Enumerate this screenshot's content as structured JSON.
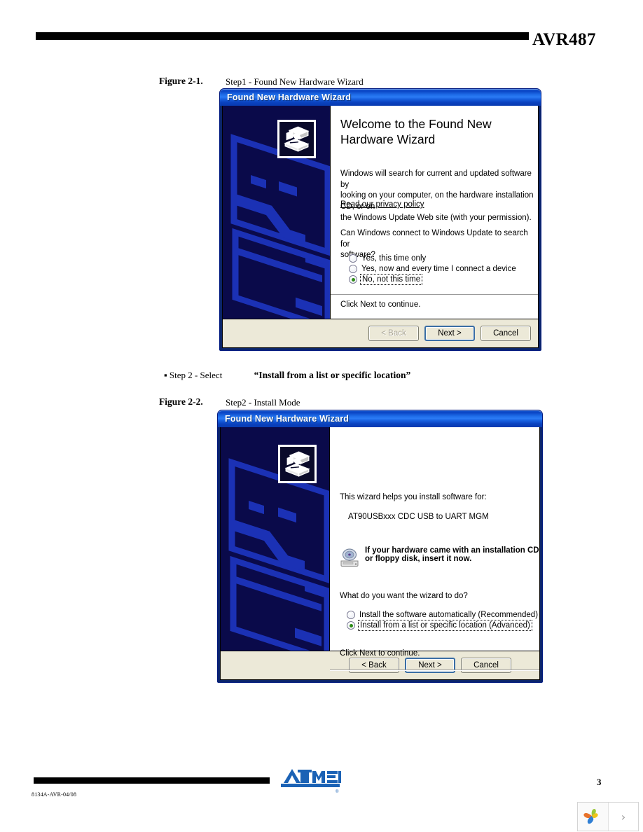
{
  "page": {
    "header_title": "AVR487",
    "footer_doc_code": "8134A-AVR-04/08",
    "page_number": "3",
    "logo_text": "ATMEL"
  },
  "figures": [
    {
      "label": "Figure 2-1.",
      "caption": "Step1 - Found New Hardware Wizard"
    },
    {
      "label": "Figure 2-2.",
      "caption": "Step2 - Install Mode"
    }
  ],
  "step_note": {
    "bullet": "▪",
    "prefix": "Step 2 - Select",
    "emphasis": "“Install from a list or specific location”"
  },
  "dialog1": {
    "title": "Found New Hardware Wizard",
    "heading_line1": "Welcome to the Found New",
    "heading_line2": "Hardware Wizard",
    "paragraph_line1": "Windows will search for current and updated software by",
    "paragraph_line2": "looking on your computer, on the hardware installation CD, or on",
    "paragraph_line3": "the Windows Update Web site (with your permission).",
    "privacy_link": "Read our privacy policy",
    "question": "Can Windows connect to Windows Update to search for",
    "question_line2": "software?",
    "options": [
      {
        "label": "Yes, this time only",
        "selected": false,
        "focused": false
      },
      {
        "label": "Yes, now and every time I connect a device",
        "selected": false,
        "focused": false
      },
      {
        "label": "No, not this time",
        "selected": true,
        "focused": true
      }
    ],
    "continue_text": "Click Next to continue.",
    "buttons": [
      {
        "label": "< Back",
        "state": "disabled",
        "default": false
      },
      {
        "label": "Next >",
        "state": "enabled",
        "default": true
      },
      {
        "label": "Cancel",
        "state": "enabled",
        "default": false
      }
    ]
  },
  "dialog2": {
    "title": "Found New Hardware Wizard",
    "intro": "This wizard helps you install software for:",
    "device_name": "AT90USBxxx CDC USB to UART MGM",
    "cd_notice_line1": "If your hardware came with an installation CD",
    "cd_notice_line2": "or floppy disk, insert it now.",
    "question": "What do you want the wizard to do?",
    "options": [
      {
        "label": "Install the software automatically (Recommended)",
        "selected": false,
        "focused": false
      },
      {
        "label": "Install from a list or specific location (Advanced)",
        "selected": true,
        "focused": true
      }
    ],
    "continue_text": "Click Next to continue.",
    "buttons": [
      {
        "label": "< Back",
        "state": "enabled",
        "default": false
      },
      {
        "label": "Next >",
        "state": "enabled",
        "default": true
      },
      {
        "label": "Cancel",
        "state": "enabled",
        "default": false
      }
    ]
  },
  "corner_widget": {
    "logo_name": "leaf-logo",
    "chevron": "›"
  },
  "colors": {
    "title_blue": "#0b47c6",
    "dialog_border": "#00197f",
    "sidebar_navy": "#0a0a4a",
    "sidebar_art": "#1b31b5",
    "button_face": "#ece9d8",
    "radio_green": "#2e8b17",
    "atmel_blue": "#1b62b5"
  }
}
